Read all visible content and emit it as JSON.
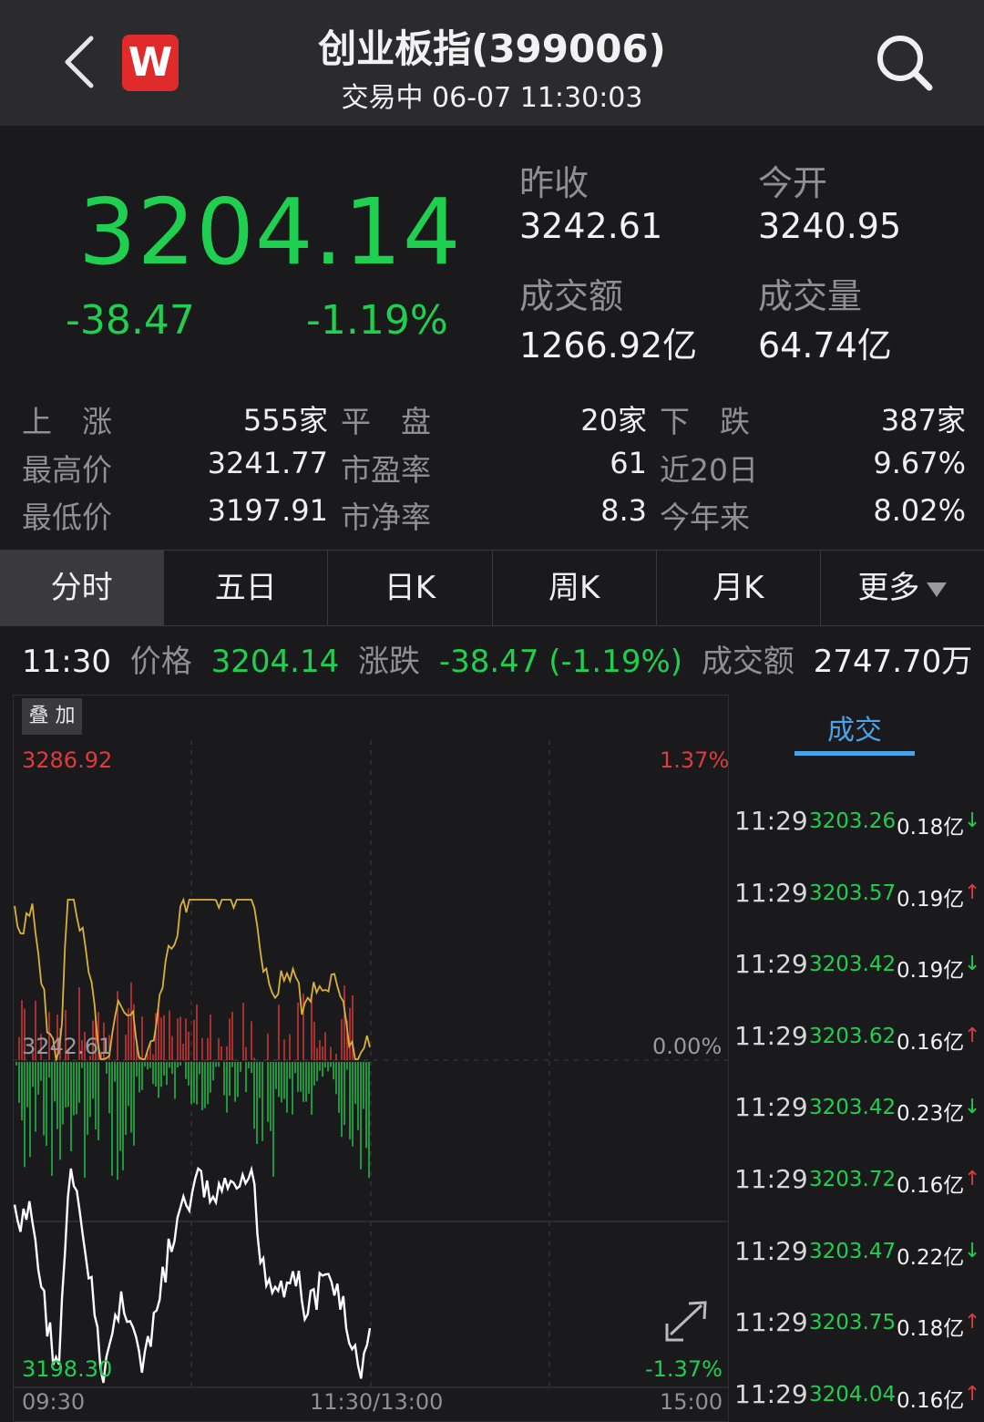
{
  "header": {
    "logo_text": "W",
    "title": "创业板指(399006)",
    "subtitle": "交易中 06-07 11:30:03"
  },
  "quote": {
    "price": "3204.14",
    "change": "-38.47",
    "change_pct": "-1.19%",
    "prev_close_label": "昨收",
    "prev_close": "3242.61",
    "open_label": "今开",
    "open": "3240.95",
    "turnover_label": "成交额",
    "turnover": "1266.92亿",
    "volume_label": "成交量",
    "volume": "64.74亿"
  },
  "stats": [
    {
      "l1": "上　涨",
      "v1": "555家",
      "l2": "平　盘",
      "v2": "20家",
      "l3": "下　跌",
      "v3": "387家"
    },
    {
      "l1": "最高价",
      "v1": "3241.77",
      "l2": "市盈率",
      "v2": "61",
      "l3": "近20日",
      "v3": "9.67%"
    },
    {
      "l1": "最低价",
      "v1": "3197.91",
      "l2": "市净率",
      "v2": "8.3",
      "l3": "今年来",
      "v3": "8.02%"
    }
  ],
  "tabs": [
    "分时",
    "五日",
    "日K",
    "周K",
    "月K",
    "更多"
  ],
  "infoline": {
    "time": "11:30",
    "price_label": "价格",
    "price": "3204.14",
    "change_label": "涨跌",
    "change": "-38.47 (-1.19%)",
    "turnover_label": "成交额",
    "turnover": "2747.70万"
  },
  "chart": {
    "overlay_label": "叠 加",
    "high": "3286.92",
    "high_pct": "1.37%",
    "mid": "3242.61",
    "mid_pct": "0.00%",
    "low": "3198.30",
    "low_pct": "-1.37%",
    "t_start": "09:30",
    "t_mid": "11:30/13:00",
    "t_end": "15:00"
  },
  "trades": {
    "tab_label": "成交",
    "rows": [
      {
        "time": "11:29",
        "price": "3203.26",
        "amount": "0.18亿",
        "dir": "down"
      },
      {
        "time": "11:29",
        "price": "3203.57",
        "amount": "0.19亿",
        "dir": "up"
      },
      {
        "time": "11:29",
        "price": "3203.42",
        "amount": "0.19亿",
        "dir": "down"
      },
      {
        "time": "11:29",
        "price": "3203.62",
        "amount": "0.16亿",
        "dir": "up"
      },
      {
        "time": "11:29",
        "price": "3203.42",
        "amount": "0.23亿",
        "dir": "down"
      },
      {
        "time": "11:29",
        "price": "3203.72",
        "amount": "0.16亿",
        "dir": "up"
      },
      {
        "time": "11:29",
        "price": "3203.47",
        "amount": "0.22亿",
        "dir": "down"
      },
      {
        "time": "11:29",
        "price": "3203.75",
        "amount": "0.18亿",
        "dir": "up"
      },
      {
        "time": "11:29",
        "price": "3204.04",
        "amount": "0.16亿",
        "dir": "up"
      }
    ]
  },
  "colors": {
    "up": "#e03a3a",
    "down": "#1fcf4f",
    "accent": "#4aa3e8",
    "line_avg": "#d9b23a"
  }
}
